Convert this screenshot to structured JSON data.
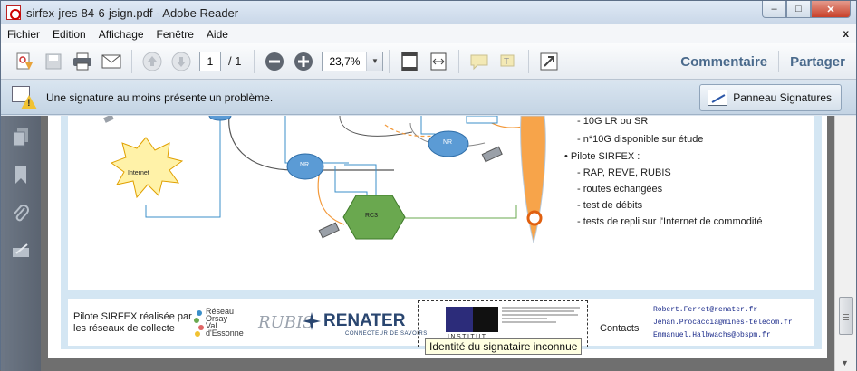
{
  "window": {
    "title": "sirfex-jres-84-6-jsign.pdf - Adobe Reader",
    "controls": {
      "minimize": "–",
      "maximize": "□",
      "close": "✕"
    }
  },
  "menu": {
    "items": [
      "Fichier",
      "Edition",
      "Affichage",
      "Fenêtre",
      "Aide"
    ],
    "close_glyph": "x"
  },
  "toolbar": {
    "page_current": "1",
    "page_total": "/ 1",
    "zoom": "23,7%",
    "comment_label": "Commentaire",
    "share_label": "Partager"
  },
  "signature_bar": {
    "message": "Une signature au moins présente un problème.",
    "panel_button": "Panneau Signatures"
  },
  "diagram": {
    "internet_label": "Internet",
    "nr_top": "NR",
    "nr_left": "NR",
    "rc3_label": "RC3"
  },
  "bullets": [
    "- 10G LR ou SR",
    "- n*10G disponible sur étude",
    "Pilote SIRFEX :",
    "- RAP, REVE, RUBIS",
    "- routes échangées",
    "- test de débits",
    "- tests de repli sur l'Internet de commodité"
  ],
  "footer": {
    "pilot_line1": "Pilote SIRFEX réalisée par",
    "pilot_line2": "les réseaux de collecte",
    "reseau_logo": [
      "Réseau",
      "Orsay",
      "Val",
      "d'Essonne"
    ],
    "rubis_logo": "RUBIS",
    "renater_logo": "RENATER",
    "renater_tagline": "CONNECTEUR DE SAVOIRS",
    "institut_text": "INSTITUT",
    "contacts_label": "Contacts",
    "emails": [
      "Robert.Ferret@renater.fr",
      "Jehan.Procaccia@mines-telecom.fr",
      "Emmanuel.Halbwachs@obspm.fr"
    ]
  },
  "tooltip": "Identité du signataire inconnue",
  "colors": {
    "accent_link": "#4a6a8c",
    "warning": "#f1c232",
    "nr_fill": "#5b9bd5",
    "rc3_fill": "#6aa84f",
    "orange_link": "#f39a3c"
  }
}
